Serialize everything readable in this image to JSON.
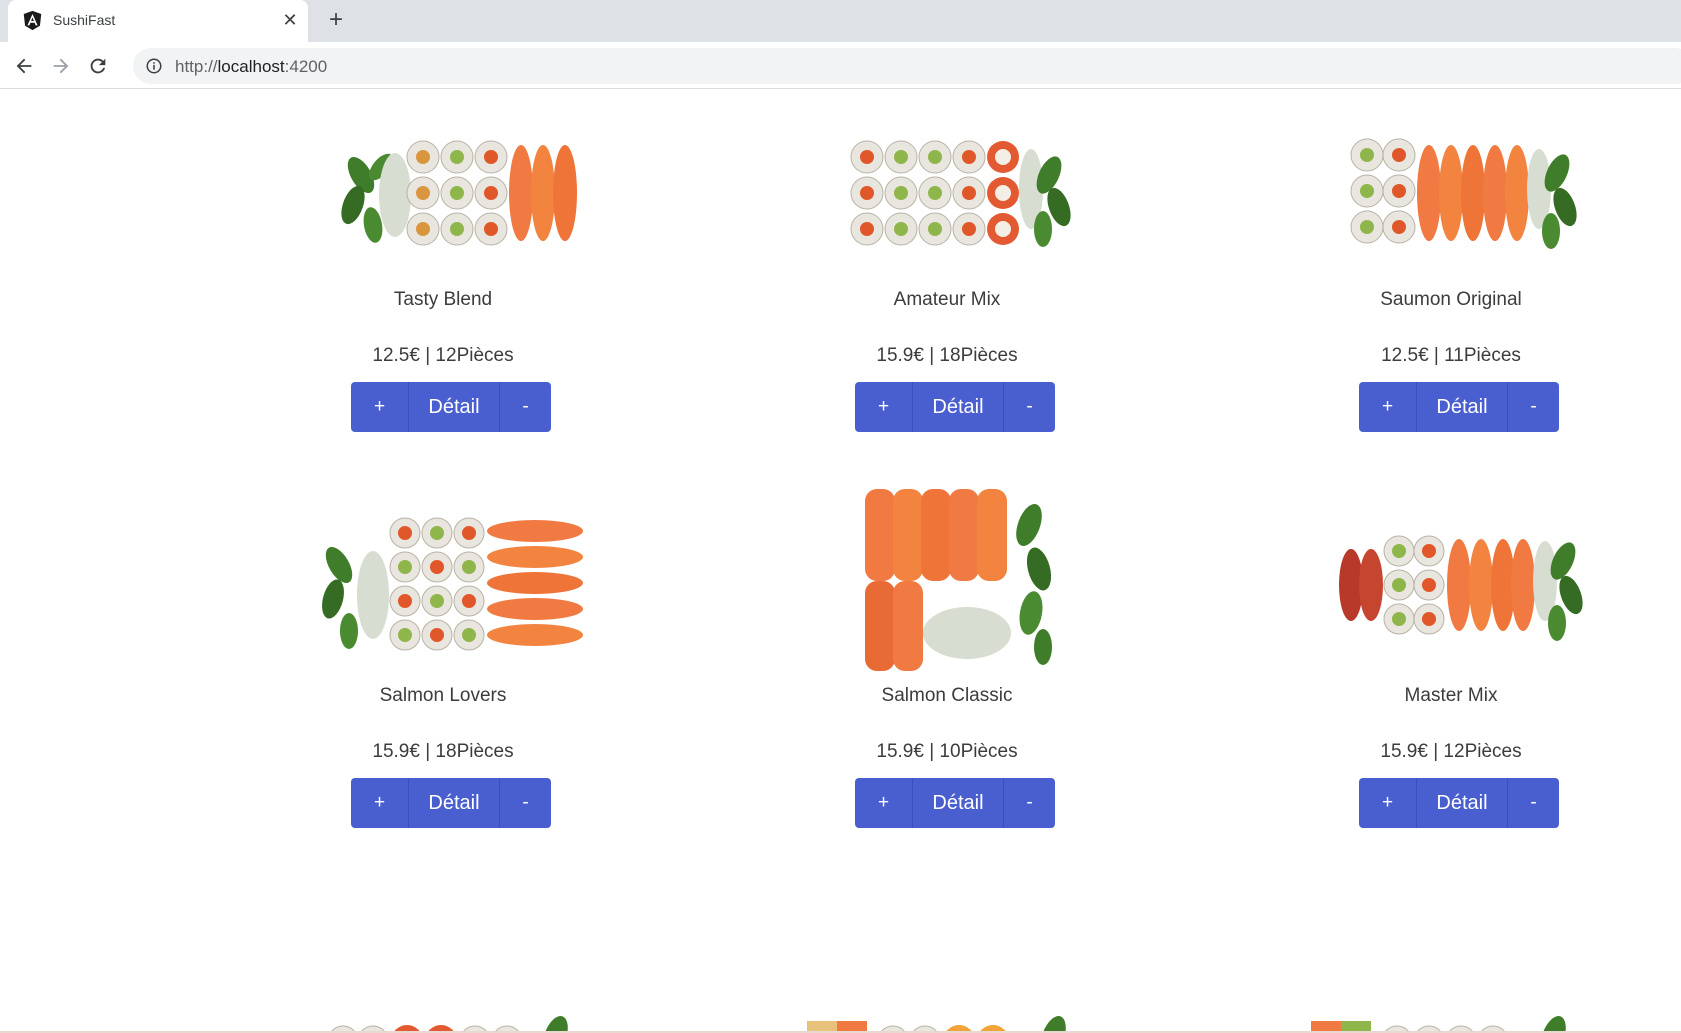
{
  "browser": {
    "tab_title": "SushiFast",
    "favicon": "angular-logo-icon",
    "url_scheme": "http://",
    "url_host": "localhost",
    "url_port": ":4200"
  },
  "products": [
    {
      "name": "Tasty Blend",
      "price": "12.5€ | 12Pièces",
      "image": "sushi-box-tasty-blend"
    },
    {
      "name": "Amateur Mix",
      "price": "15.9€ | 18Pièces",
      "image": "sushi-box-amateur-mix"
    },
    {
      "name": "Saumon Original",
      "price": "12.5€ | 11Pièces",
      "image": "sushi-box-saumon-original"
    },
    {
      "name": "Salmon Lovers",
      "price": "15.9€ | 18Pièces",
      "image": "sushi-box-salmon-lovers"
    },
    {
      "name": "Salmon Classic",
      "price": "15.9€ | 10Pièces",
      "image": "sushi-box-salmon-classic"
    },
    {
      "name": "Master Mix",
      "price": "15.9€ | 12Pièces",
      "image": "sushi-box-master-mix"
    }
  ],
  "buttons": {
    "plus": "+",
    "detail": "Détail",
    "minus": "-"
  },
  "colors": {
    "button_bg": "#4a5fcf",
    "salmon": "#f07a42",
    "edamame": "#3f7d2a",
    "rice": "#e9e6df",
    "nori": "#2f3a2c"
  }
}
